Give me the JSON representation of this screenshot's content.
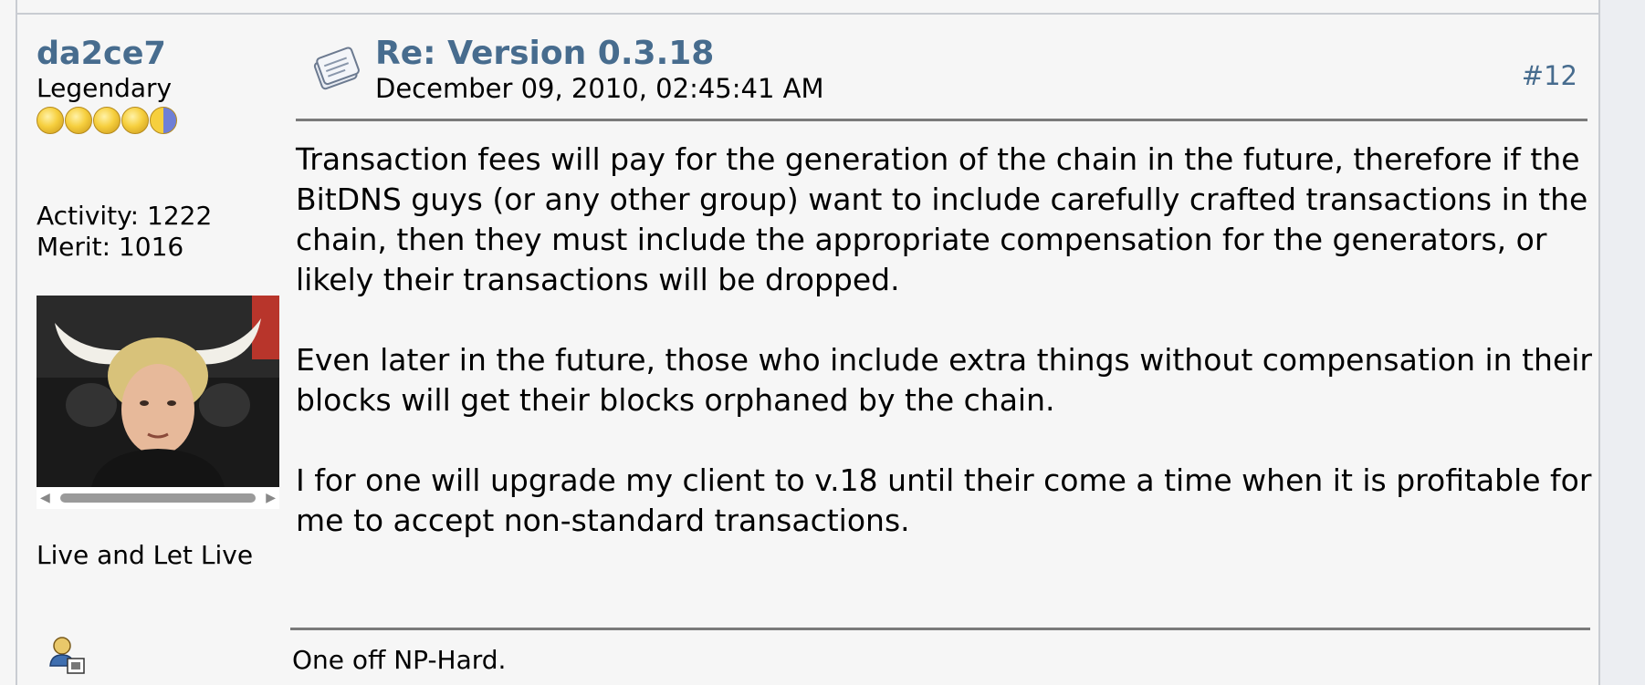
{
  "poster": {
    "username": "da2ce7",
    "rank": "Legendary",
    "rank_stars": 5,
    "activity": "Activity: 1222",
    "merit": "Merit: 1016",
    "personal_text": "Live and Let Live"
  },
  "post": {
    "subject": "Re: Version 0.3.18",
    "date": "December 09, 2010, 02:45:41 AM",
    "number": "#12",
    "paragraphs": [
      "Transaction fees will pay for the generation of the chain in the future, therefore if the BitDNS guys (or any other group) want to include carefully crafted transactions in the chain, then they must include the appropriate compensation for the generators, or likely their transactions will be dropped.",
      "Even later in the future, those who include extra things without compensation in their blocks will get their blocks orphaned by the chain.",
      "I for one will upgrade my client to v.18 until their come a time when it is profitable for me to accept non-standard transactions."
    ],
    "signature": "One off NP-Hard."
  },
  "colors": {
    "link_blue": "#476c8e",
    "background": "#f6f6f6",
    "rule": "#7a7a7a"
  },
  "icons": {
    "message": "message-icon",
    "profile": "profile-icon"
  }
}
